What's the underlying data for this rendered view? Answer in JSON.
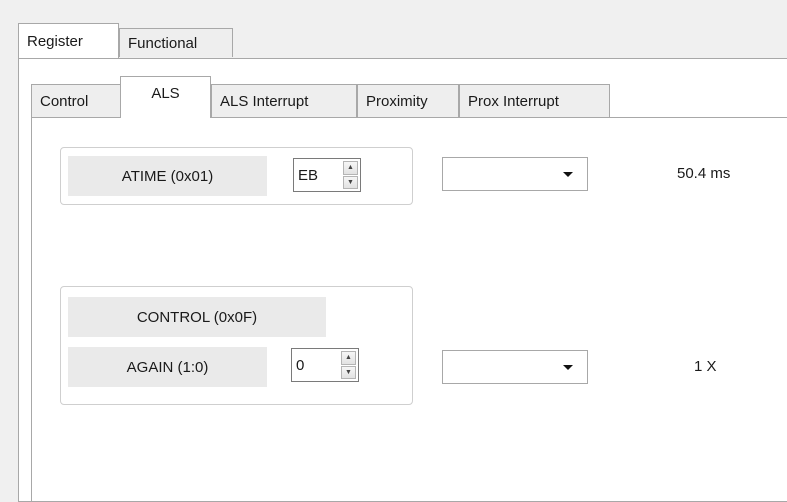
{
  "outer_tabs": [
    {
      "label": "Register",
      "active": true
    },
    {
      "label": "Functional",
      "active": false
    }
  ],
  "inner_tabs": [
    {
      "label": "Control",
      "active": false
    },
    {
      "label": "ALS",
      "active": true
    },
    {
      "label": "ALS Interrupt",
      "active": false
    },
    {
      "label": "Proximity",
      "active": false
    },
    {
      "label": "Prox Interrupt",
      "active": false
    }
  ],
  "atime": {
    "label": "ATIME (0x01)",
    "spinner_value": "EB",
    "dropdown_value": "",
    "readout": "50.4 ms"
  },
  "control": {
    "group_label": "CONTROL (0x0F)",
    "again_label": "AGAIN (1:0)",
    "spinner_value": "0",
    "dropdown_value": "",
    "readout": "1 X"
  },
  "icons": {
    "spin_up": "▲",
    "spin_down": "▼"
  }
}
